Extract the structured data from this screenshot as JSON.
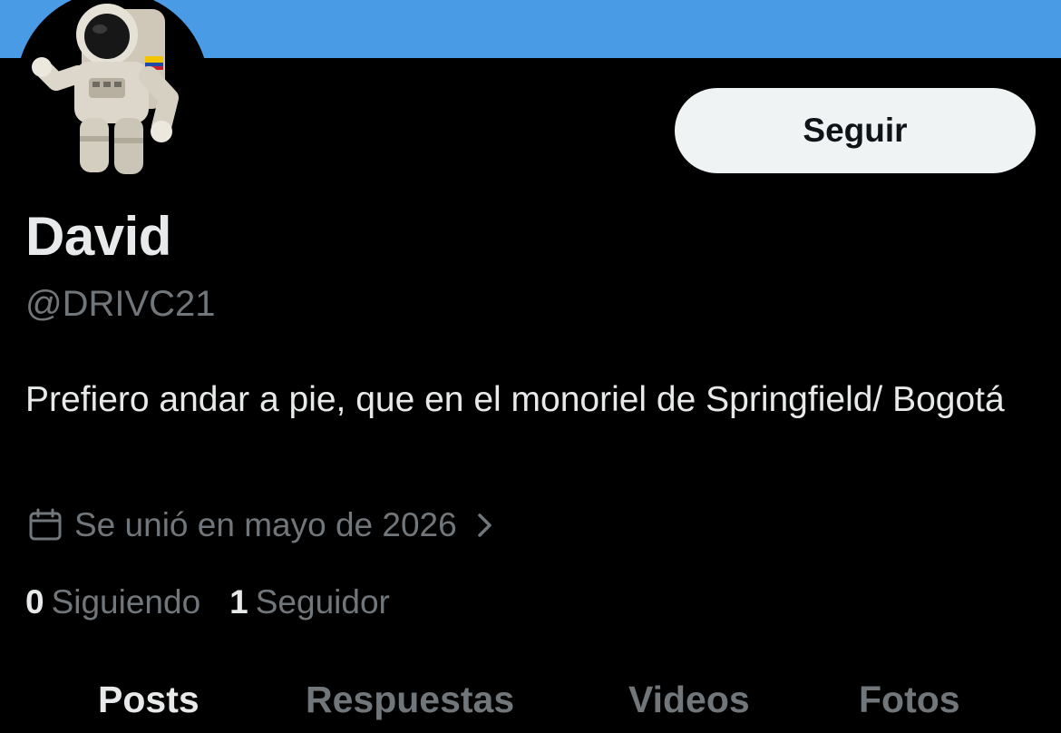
{
  "profile": {
    "display_name": "David",
    "handle": "@DRIVC21",
    "bio": "Prefiero andar a pie, que en el monoriel de Springfield/ Bogotá",
    "joined": "Se unió en mayo de 2026",
    "following_count": "0",
    "following_label": "Siguiendo",
    "followers_count": "1",
    "followers_label": "Seguidor"
  },
  "actions": {
    "follow_label": "Seguir"
  },
  "tabs": [
    {
      "label": "Posts",
      "active": true
    },
    {
      "label": "Respuestas",
      "active": false
    },
    {
      "label": "Videos",
      "active": false
    },
    {
      "label": "Fotos",
      "active": false
    }
  ],
  "colors": {
    "banner": "#4a9be6",
    "background": "#000000",
    "text_primary": "#e7e9ea",
    "text_secondary": "#71767b",
    "button_bg": "#eff3f4",
    "button_text": "#0f1419"
  },
  "icons": {
    "avatar": "astronaut-avatar",
    "joined": "calendar-icon",
    "joined_more": "chevron-right-icon"
  }
}
